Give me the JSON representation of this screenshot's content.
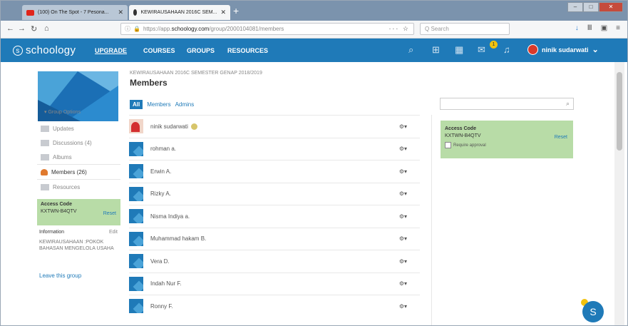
{
  "browser": {
    "tabs": [
      {
        "label": "(100) On The Spot - 7 Pesona...",
        "active": false
      },
      {
        "label": "KEWIRAUSAHAAN 2016C SEM...",
        "active": true
      }
    ],
    "new_tab": "+",
    "url_prefix": "https://app.",
    "url_domain": "schoology.com",
    "url_path": "/group/2000104081/members",
    "url_tail": "··· ☆",
    "search_placeholder": "Q Search"
  },
  "header": {
    "logo": "schoology",
    "menu": [
      "UPGRADE",
      "COURSES",
      "GROUPS",
      "RESOURCES"
    ],
    "notification_count": "1",
    "user_name": "ninik sudarwati"
  },
  "sidebar": {
    "group_options": "▾ Group Options",
    "items": [
      {
        "label": "Updates"
      },
      {
        "label": "Discussions (4)"
      },
      {
        "label": "Albums"
      },
      {
        "label": "Members (26)"
      },
      {
        "label": "Resources"
      }
    ],
    "access": {
      "title": "Access Code",
      "code": "KXTWN-B4QTV",
      "reset": "Reset"
    },
    "info_title": "Information",
    "info_edit": "Edit",
    "info_desc": "KEWIRAUSAHAAN :POKOK BAHASAN MENGELOLA USAHA",
    "leave": "Leave this group"
  },
  "main": {
    "breadcrumb": "KEWIRAUSAHAAN 2016C SEMESTER GENAP 2018/2019",
    "title": "Members",
    "filters": {
      "all": "All",
      "members": "Members",
      "admins": "Admins"
    },
    "members": [
      {
        "name": "ninik sudarwati"
      },
      {
        "name": "rohman a."
      },
      {
        "name": "Erwin A."
      },
      {
        "name": "Rizky A."
      },
      {
        "name": "Nisma Indiya a."
      },
      {
        "name": "Muhammad hakam B."
      },
      {
        "name": "Vera D."
      },
      {
        "name": "Indah Nur F."
      },
      {
        "name": "Ronny F."
      }
    ],
    "gear": "⚙▾"
  },
  "right": {
    "access_title": "Access Code",
    "access_code": "KXTWN-B4QTV",
    "reset": "Reset",
    "require": "Require approval"
  },
  "fab_label": "S"
}
